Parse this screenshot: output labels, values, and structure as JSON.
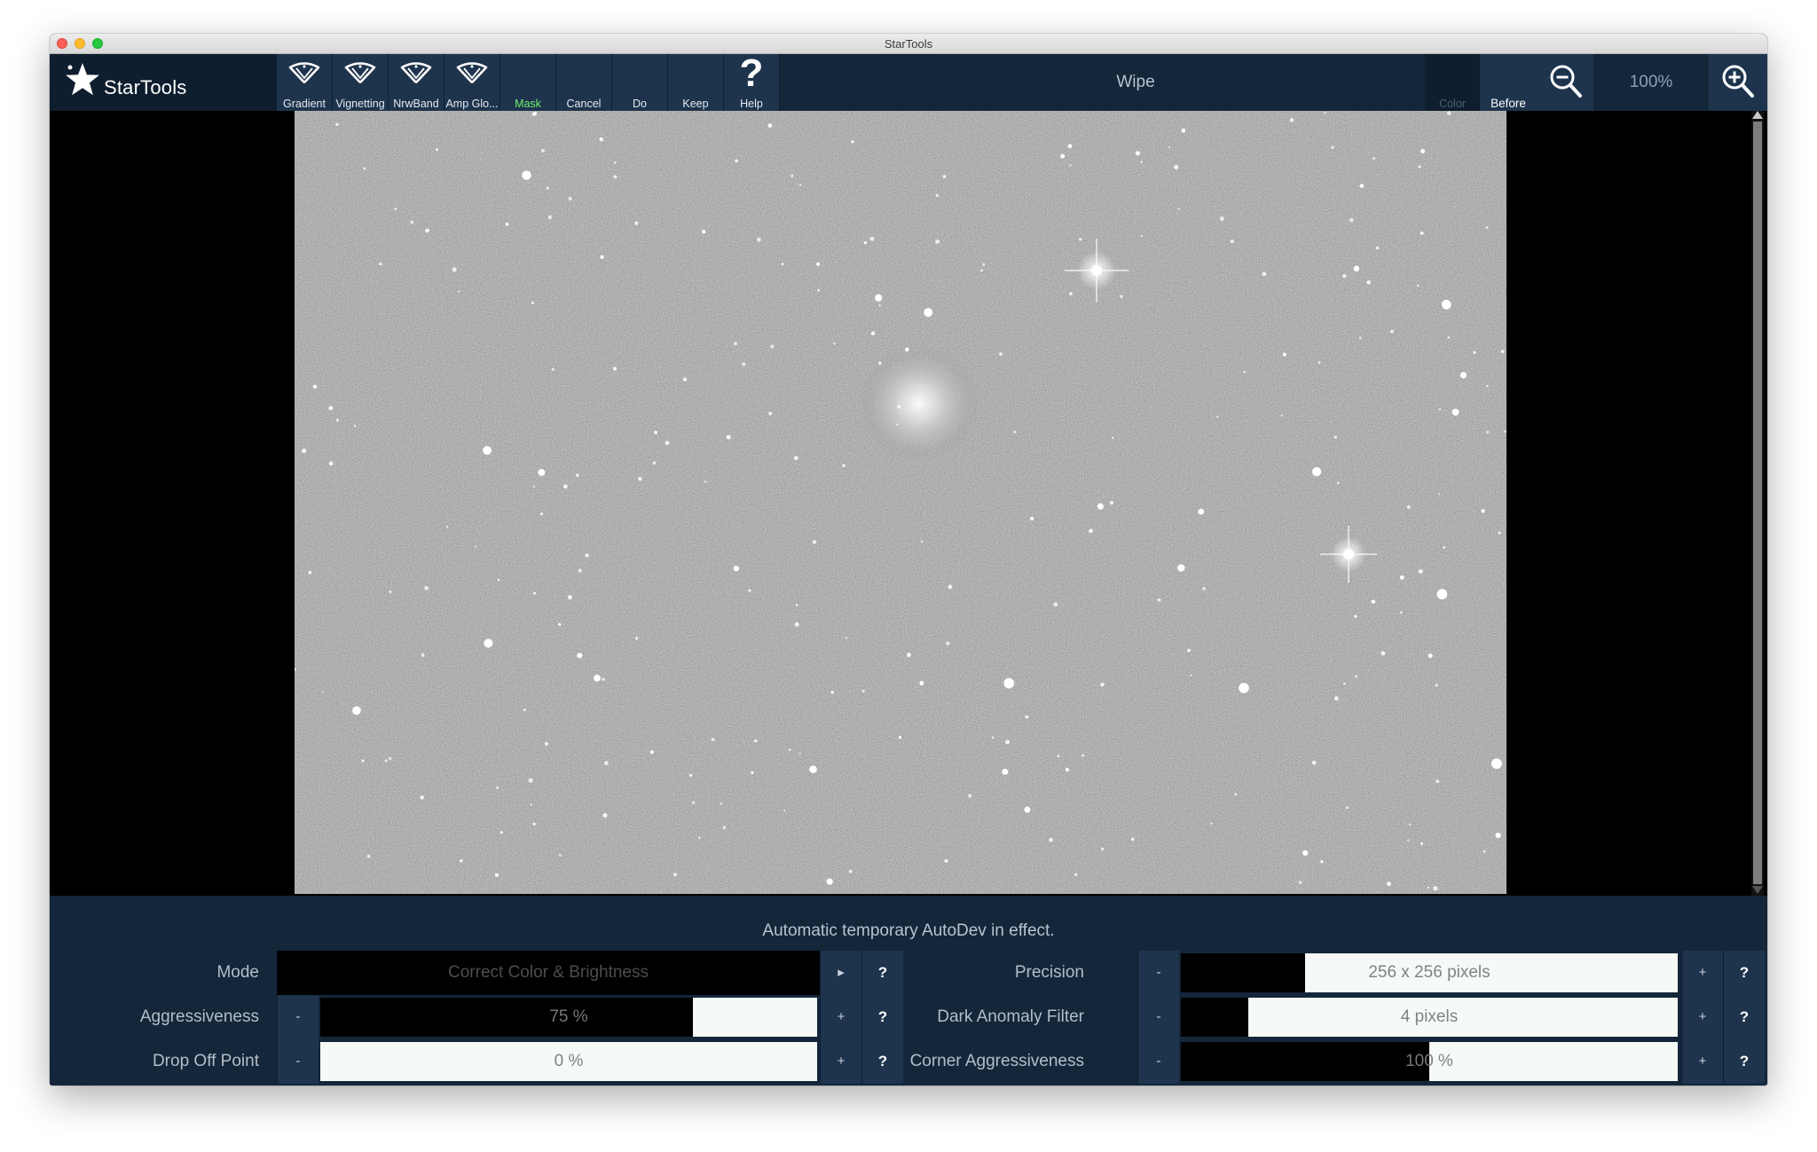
{
  "window": {
    "title": "StarTools"
  },
  "app": {
    "name": "StarTools"
  },
  "toolbar": {
    "buttons": [
      {
        "label": "Gradient",
        "icon": "wipe-icon"
      },
      {
        "label": "Vignetting",
        "icon": "wipe-icon"
      },
      {
        "label": "NrwBand",
        "icon": "wipe-icon"
      },
      {
        "label": "Amp Glo...",
        "icon": "wipe-icon"
      },
      {
        "label": "Mask",
        "color": "#6ff06f"
      },
      {
        "label": "Cancel"
      },
      {
        "label": "Do"
      },
      {
        "label": "Keep"
      },
      {
        "label": "Help",
        "icon": "question-icon"
      }
    ],
    "tool_title": "Wipe",
    "color_label": "Color",
    "before_label": "Before",
    "zoom": "100%"
  },
  "image_view": {
    "subject": "star field with spiral galaxy"
  },
  "panel": {
    "status": "Automatic temporary AutoDev in effect.",
    "mode": {
      "label": "Mode",
      "value": "Correct Color & Brightness"
    },
    "aggressiveness": {
      "label": "Aggressiveness",
      "value": "75 %",
      "fraction": 0.75
    },
    "drop_off_point": {
      "label": "Drop Off Point",
      "value": "0 %",
      "fraction": 0.0
    },
    "precision": {
      "label": "Precision",
      "value": "256 x 256 pixels",
      "fraction": 0.25
    },
    "dark_anomaly_filter": {
      "label": "Dark Anomaly Filter",
      "value": "4 pixels",
      "fraction": 0.136
    },
    "corner_aggressiveness": {
      "label": "Corner Aggressiveness",
      "value": "100 %",
      "fraction": 0.5
    },
    "minus": "-",
    "plus": "+",
    "help": "?",
    "arrow": "▸"
  },
  "colors": {
    "toolbar_bg": "#14263a",
    "button_bg": "#1e344d",
    "mask_green": "#6ff06f"
  }
}
